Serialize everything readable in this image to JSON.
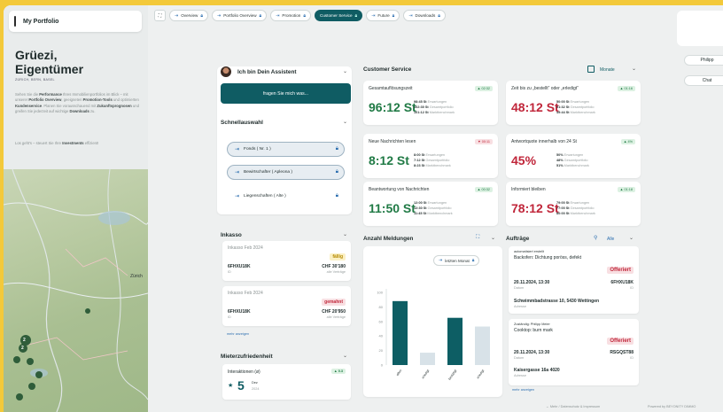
{
  "brand": {
    "title": "My Portfolio"
  },
  "sidebar": {
    "greeting": "Grüezi,\nEigentümer",
    "location": "ZÜRICH, BERN, BASEL",
    "intro_parts": [
      "Sehen Sie die ",
      "Performance",
      " Ihres Immobilienportfolios im Blick – mit unserer ",
      "Portfolio Overview",
      ", geeigneten ",
      "Promotion-Tools",
      " und optimierten ",
      "Kundenservice",
      ". Planen Sie vorausschauend mit ",
      "Zukunftsprognosen",
      " und greifen Sie jederzeit auf wichtige ",
      "Downloads",
      " zu."
    ],
    "intro2_parts": [
      "Los geht's – steuert Sie Ihre ",
      "Investments",
      " effizient!"
    ],
    "map_label": "Zürich",
    "map_markers": [
      {
        "value": "2"
      },
      {
        "value": "2"
      }
    ]
  },
  "nav": {
    "items": [
      {
        "label": "Overview"
      },
      {
        "label": "Portfolio Overview"
      },
      {
        "label": "Promotion"
      },
      {
        "label": "Customer Service"
      },
      {
        "label": "Future"
      },
      {
        "label": "Downloads"
      }
    ],
    "active": "Customer Service"
  },
  "user": {
    "name": "Philipp",
    "chat": "Chat"
  },
  "assistant": {
    "title": "Ich bin Dein Assistent",
    "button": "fragen Sie mich was..."
  },
  "quick": {
    "title": "Schnellauswahl",
    "items": [
      {
        "label": "Fonds ( Nr. 1 )"
      },
      {
        "label": "Bewirtschafter ( Apleona )"
      },
      {
        "label": "Liegenschaften ( Alte )"
      }
    ]
  },
  "inkasso": {
    "title": "Inkasso",
    "items": [
      {
        "period": "Inkasso Feb 2024",
        "status": "fällig",
        "id": "6FHXU18K",
        "id_sub": "ID",
        "amount": "CHF 30'180",
        "amount_sub": "alle Verträge"
      },
      {
        "period": "Inkasso Feb 2024",
        "status": "gemahnt",
        "id": "6FHXU18K",
        "id_sub": "ID",
        "amount": "CHF 20'950",
        "amount_sub": "alle Verträge"
      }
    ],
    "more": "mehr anzeigen"
  },
  "tenant": {
    "title": "Mieterzufriedenheit",
    "item_title": "Interaktionen (ø)",
    "item_tag": "▲ 0.3",
    "score": "5",
    "score_label": "Dez",
    "score_sub": "2024"
  },
  "cs": {
    "title": "Customer Service",
    "period": "Monate",
    "metrics": [
      {
        "title": "Gesamtauflösungszeit",
        "tag": "▲ 02:32",
        "value": "96:12 St",
        "lines": [
          [
            "98:45 St",
            "Erwartungen"
          ],
          [
            "102:30 St",
            "Gesamtportfolio"
          ],
          [
            "101:12 St",
            "Marktbenchmark"
          ]
        ]
      },
      {
        "title": "Zeit bis zu „bestellt“ oder „erledigt“",
        "tag": "▲ 01:16",
        "value": "48:12 St",
        "lines": [
          [
            "50:00 St",
            "Erwartungen"
          ],
          [
            "51:32 St",
            "Gesamtportfolio"
          ],
          [
            "49:44 St",
            "Marktbenchmark"
          ]
        ]
      },
      {
        "title": "Neue Nachrichten lesen",
        "tag": "▼ 00:11",
        "value": "8:12 St",
        "lines": [
          [
            "8:00 St",
            "Erwartungen"
          ],
          [
            "7:12 St",
            "Gesamtportfolio"
          ],
          [
            "8:23 St",
            "Marktbenchmark"
          ]
        ]
      },
      {
        "title": "Antwortquote innerhalb von 24 St",
        "tag": "▲ 4%",
        "value": "45%",
        "lines": [
          [
            "50%",
            "Erwartungen"
          ],
          [
            "48%",
            "Gesamtportfolio"
          ],
          [
            "51%",
            "Marktbenchmark"
          ]
        ]
      },
      {
        "title": "Beantwortung von Nachrichten",
        "tag": "▲ 00:32",
        "value": "11:50 St",
        "lines": [
          [
            "12:00 St",
            "Erwartungen"
          ],
          [
            "12:30 St",
            "Gesamtportfolio"
          ],
          [
            "11:45 St",
            "Marktbenchmark"
          ]
        ]
      },
      {
        "title": "Informiert bleiben",
        "tag": "▲ 01:18",
        "value": "78:12 St",
        "lines": [
          [
            "79:00 St",
            "Erwartungen"
          ],
          [
            "77:00 St",
            "Gesamtportfolio"
          ],
          [
            "80:00 St",
            "Marktbenchmark"
          ]
        ]
      }
    ]
  },
  "meldungen": {
    "title": "Anzahl Meldungen",
    "filter": "letzten Monat"
  },
  "chart_data": {
    "type": "bar",
    "categories": [
      "offen",
      "erledigt",
      "bestätigt",
      "erledigt"
    ],
    "values": [
      88,
      17,
      65,
      53
    ],
    "ylim": [
      0,
      100
    ],
    "yticks": [
      "100",
      "80",
      "60",
      "40",
      "20",
      "0"
    ],
    "colors": [
      "#0d5e64",
      "#d8e2e8",
      "#0d5e64",
      "#d8e2e8"
    ],
    "xlabel": "",
    "ylabel": ""
  },
  "auftraege": {
    "title": "Aufträge",
    "filter": "Alle",
    "items": [
      {
        "by": "automatisiert erstellt",
        "title": "Backofen: Dichtung poröss, defekt",
        "status": "Offeriert",
        "date": "20.11.2024, 13:30",
        "date_sub": "Datum",
        "id": "6FHXU18K",
        "id_sub": "ID",
        "address": "Schwimmbadstrasse 10, 5430 Wettingen",
        "address_sub": "Adresse"
      },
      {
        "by": "Zuständig: Philipp Meier",
        "title": "Cooktop: burn mark",
        "status": "Offeriert",
        "date": "20.11.2024, 13:30",
        "date_sub": "Datum",
        "id": "RSGQST88",
        "id_sub": "ID",
        "address": "Kaisergasse 16a 4020",
        "address_sub": "Adresse"
      }
    ],
    "more": "mehr anzeigen"
  },
  "footer": {
    "links": "← Mehr / Datenschutz & Impressum",
    "powered": "Powered by BEYONITY DIMMO"
  }
}
